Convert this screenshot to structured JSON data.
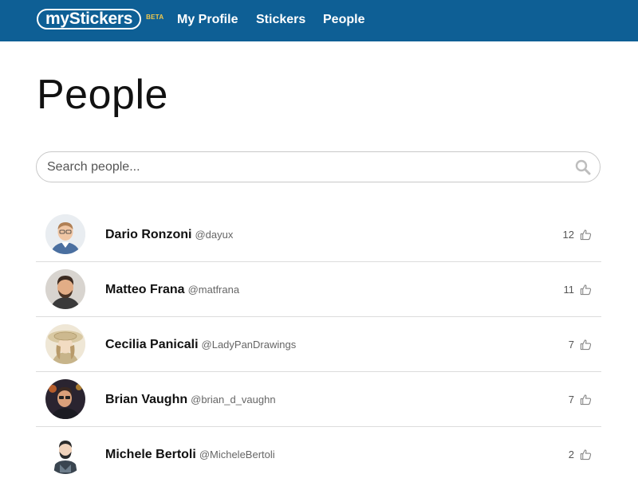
{
  "nav": {
    "logo": "myStickers",
    "badge": "BETA",
    "links": [
      "My Profile",
      "Stickers",
      "People"
    ]
  },
  "page": {
    "title": "People"
  },
  "search": {
    "placeholder": "Search people...",
    "value": "",
    "icon": "search-icon"
  },
  "people": [
    {
      "name": "Dario Ronzoni",
      "handle": "@dayux",
      "likes": "12",
      "avatar": "avatar-dario"
    },
    {
      "name": "Matteo Frana",
      "handle": "@matfrana",
      "likes": "11",
      "avatar": "avatar-matteo"
    },
    {
      "name": "Cecilia Panicali",
      "handle": "@LadyPanDrawings",
      "likes": "7",
      "avatar": "avatar-cecilia"
    },
    {
      "name": "Brian Vaughn",
      "handle": "@brian_d_vaughn",
      "likes": "7",
      "avatar": "avatar-brian"
    },
    {
      "name": "Michele Bertoli",
      "handle": "@MicheleBertoli",
      "likes": "2",
      "avatar": "avatar-michele"
    }
  ],
  "colors": {
    "navbar": "#0e5f95",
    "badge": "#f2c94c",
    "divider": "#dcdcdc"
  }
}
